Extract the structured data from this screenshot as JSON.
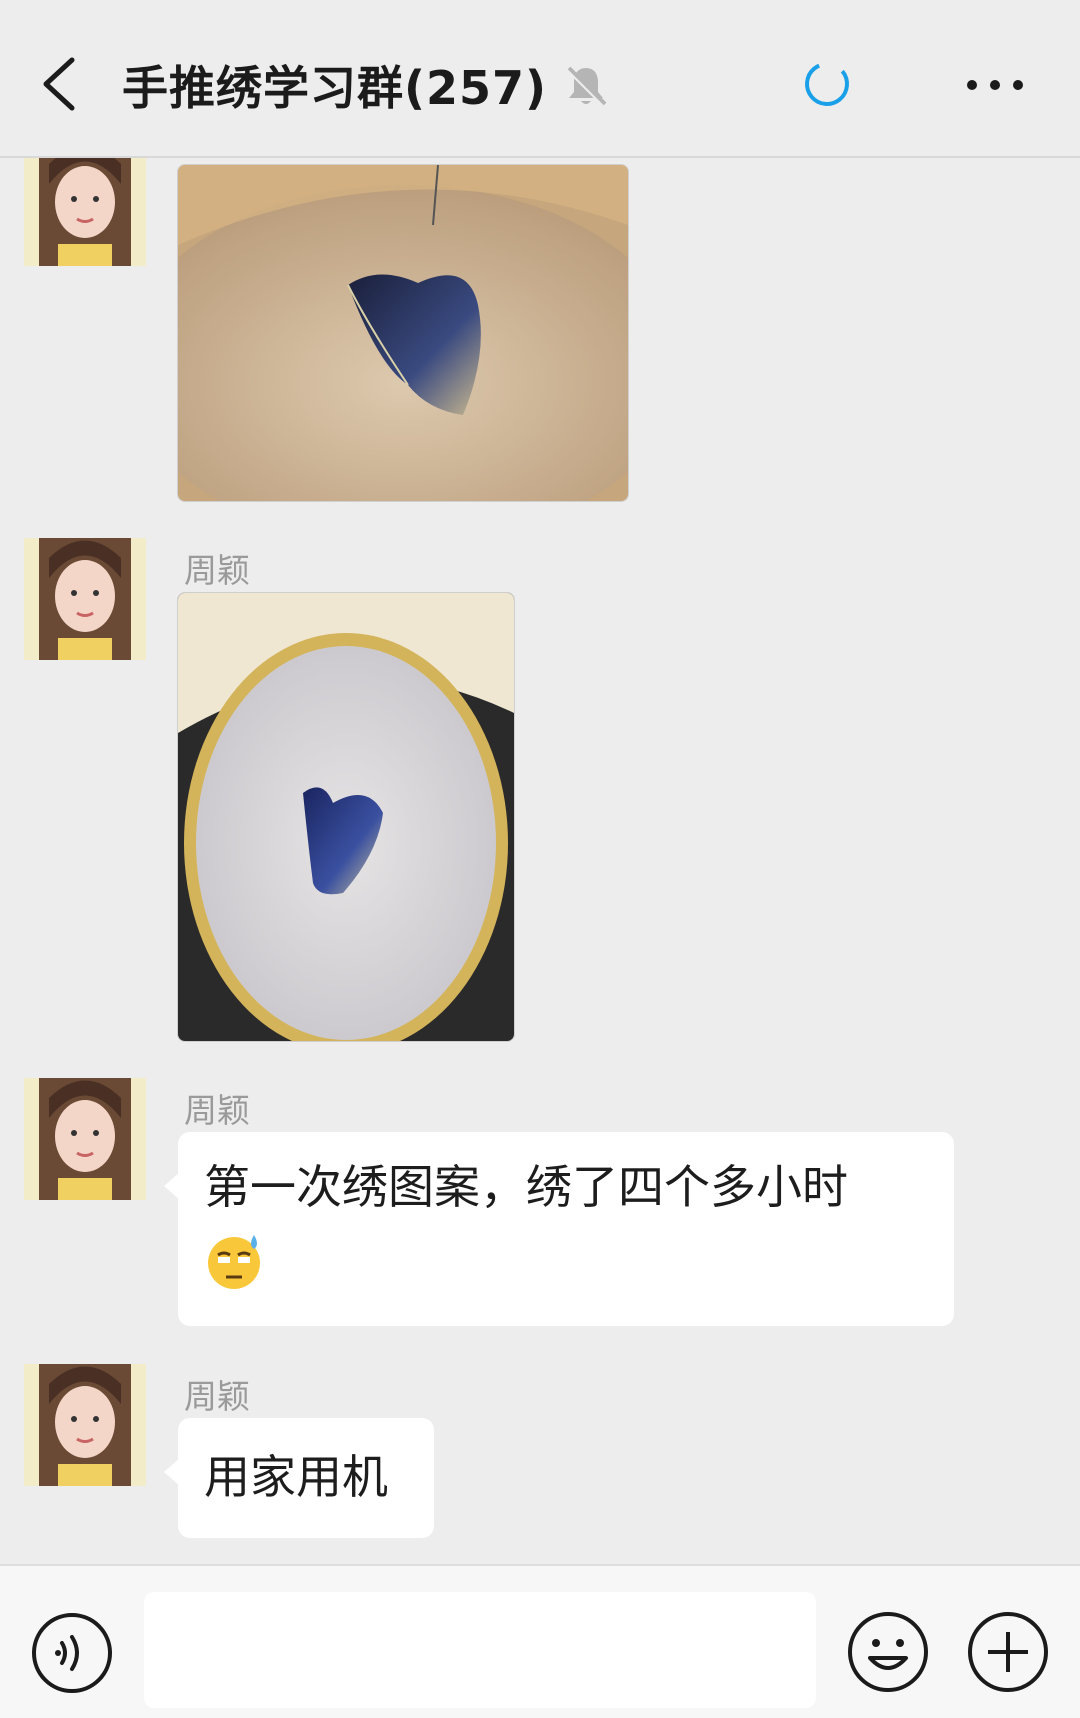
{
  "header": {
    "title": "手推绣学习群(257)"
  },
  "messages": [
    {
      "type": "image",
      "sender": "",
      "image": "butterfly-on-hoop-top-view",
      "hoop_orientation": "landscape"
    },
    {
      "type": "image",
      "sender": "周颖",
      "image": "butterfly-on-hoop-front-view",
      "hoop_orientation": "portrait"
    },
    {
      "type": "text",
      "sender": "周颖",
      "text": "第一次绣图案，绣了四个多小时",
      "emoji": "sweat-smile-emoji"
    },
    {
      "type": "text",
      "sender": "周颖",
      "text": "用家用机"
    }
  ],
  "input": {
    "value": ""
  },
  "colors": {
    "accent": "#1aa0e8",
    "background": "#ededed",
    "bubble": "#ffffff"
  },
  "icons": {
    "back": "chevron-left-icon",
    "mute": "bell-muted-icon",
    "loading": "spinner-icon",
    "more": "more-dots-icon",
    "voice": "voice-icon",
    "emoji": "smiley-icon",
    "add": "plus-circle-icon"
  }
}
